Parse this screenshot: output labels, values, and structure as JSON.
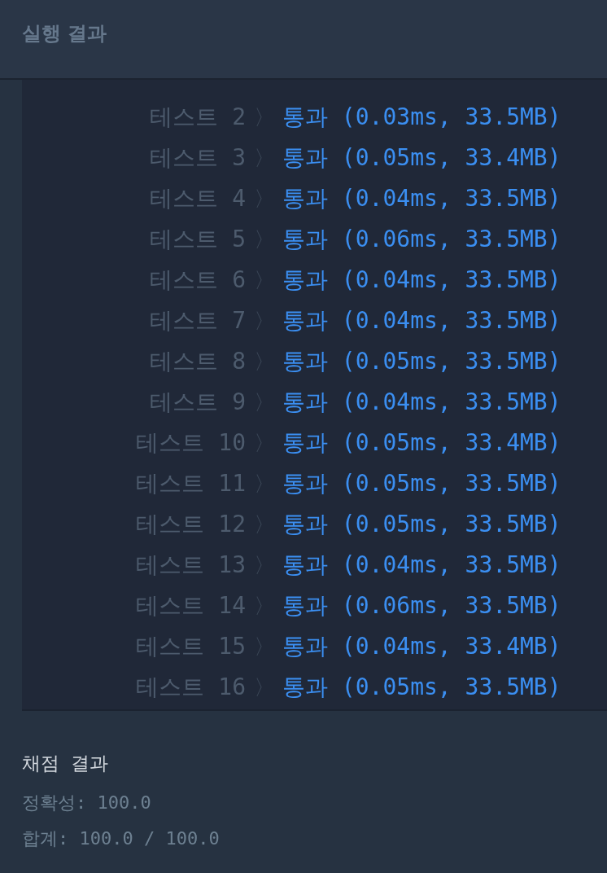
{
  "header": {
    "title": "실행 결과"
  },
  "tests": [
    {
      "label": "테스트 2",
      "separator": "〉",
      "result": "통과 (0.03ms, 33.5MB)"
    },
    {
      "label": "테스트 3",
      "separator": "〉",
      "result": "통과 (0.05ms, 33.4MB)"
    },
    {
      "label": "테스트 4",
      "separator": "〉",
      "result": "통과 (0.04ms, 33.5MB)"
    },
    {
      "label": "테스트 5",
      "separator": "〉",
      "result": "통과 (0.06ms, 33.5MB)"
    },
    {
      "label": "테스트 6",
      "separator": "〉",
      "result": "통과 (0.04ms, 33.5MB)"
    },
    {
      "label": "테스트 7",
      "separator": "〉",
      "result": "통과 (0.04ms, 33.5MB)"
    },
    {
      "label": "테스트 8",
      "separator": "〉",
      "result": "통과 (0.05ms, 33.5MB)"
    },
    {
      "label": "테스트 9",
      "separator": "〉",
      "result": "통과 (0.04ms, 33.5MB)"
    },
    {
      "label": "테스트 10",
      "separator": "〉",
      "result": "통과 (0.05ms, 33.4MB)"
    },
    {
      "label": "테스트 11",
      "separator": "〉",
      "result": "통과 (0.05ms, 33.5MB)"
    },
    {
      "label": "테스트 12",
      "separator": "〉",
      "result": "통과 (0.05ms, 33.5MB)"
    },
    {
      "label": "테스트 13",
      "separator": "〉",
      "result": "통과 (0.04ms, 33.5MB)"
    },
    {
      "label": "테스트 14",
      "separator": "〉",
      "result": "통과 (0.06ms, 33.5MB)"
    },
    {
      "label": "테스트 15",
      "separator": "〉",
      "result": "통과 (0.04ms, 33.4MB)"
    },
    {
      "label": "테스트 16",
      "separator": "〉",
      "result": "통과 (0.05ms, 33.5MB)"
    }
  ],
  "grading": {
    "title": "채점 결과",
    "lines": [
      "정확성: 100.0",
      "합계: 100.0 / 100.0"
    ]
  }
}
